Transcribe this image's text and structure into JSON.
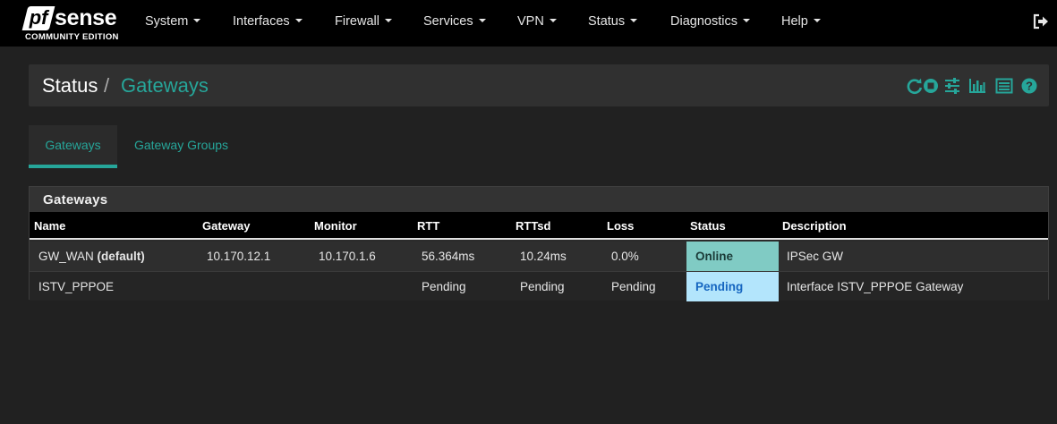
{
  "logo": {
    "pf": "pf",
    "sense": "sense",
    "edition": "COMMUNITY EDITION"
  },
  "nav": {
    "items": [
      {
        "label": "System"
      },
      {
        "label": "Interfaces"
      },
      {
        "label": "Firewall"
      },
      {
        "label": "Services"
      },
      {
        "label": "VPN"
      },
      {
        "label": "Status"
      },
      {
        "label": "Diagnostics"
      },
      {
        "label": "Help"
      }
    ],
    "logout_icon": "sign-out-icon"
  },
  "breadcrumb": {
    "parent": "Status",
    "separator": "/",
    "current": "Gateways"
  },
  "header_icons": [
    "refresh-icon",
    "stop-circle-icon",
    "sliders-icon",
    "bar-chart-icon",
    "log-list-icon",
    "help-icon"
  ],
  "tabs": [
    {
      "label": "Gateways",
      "active": true
    },
    {
      "label": "Gateway Groups",
      "active": false
    }
  ],
  "panel": {
    "title": "Gateways",
    "columns": [
      "Name",
      "Gateway",
      "Monitor",
      "RTT",
      "RTTsd",
      "Loss",
      "Status",
      "Description"
    ],
    "rows": [
      {
        "name": "GW_WAN",
        "name_suffix": "(default)",
        "gateway": "10.170.12.1",
        "monitor": "10.170.1.6",
        "rtt": "56.364ms",
        "rttsd": "10.24ms",
        "loss": "0.0%",
        "status": "Online",
        "description": "IPSec GW"
      },
      {
        "name": "ISTV_PPPOE",
        "name_suffix": "",
        "gateway": "",
        "monitor": "",
        "rtt": "Pending",
        "rttsd": "Pending",
        "loss": "Pending",
        "status": "Pending",
        "description": "Interface ISTV_PPPOE Gateway"
      }
    ]
  },
  "colors": {
    "accent": "#26a69a",
    "online": "#80cbc4",
    "pending": "#b3e5fc",
    "online_text": "#1b3b38",
    "pending_text": "#1565c0"
  }
}
